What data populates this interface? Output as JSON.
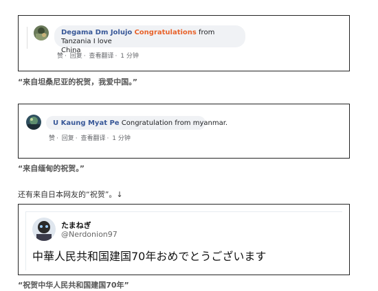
{
  "post1": {
    "name": "Degama Dm Jolujo",
    "highlight": "Congratulations",
    "text_rest": " from Tanzania I love",
    "text_line2": "China",
    "actions": [
      "赞",
      "·",
      "回复",
      "·",
      "查看翻译",
      "·",
      "1 分钟"
    ],
    "caption": "“来自坦桑尼亚的祝贺，我爱中国。”"
  },
  "post2": {
    "name": "U Kaung Myat Pe",
    "text": " Congratulation from myanmar.",
    "actions": [
      "赞",
      "·",
      "回复",
      "·",
      "查看翻译",
      "·",
      "1 分钟"
    ],
    "caption": "“来自缅甸的祝贺。”"
  },
  "note": "还有来自日本网友的“祝贺”。↓",
  "tweet": {
    "name": "たまねぎ",
    "handle": "@Nerdonion97",
    "text": "中華人民共和国建国70年おめでとうございます",
    "caption": "“祝贺中华人民共和国建国70年”"
  },
  "colors": {
    "name": "#385898",
    "highlight": "#e8632b",
    "border": "#222222"
  },
  "icons": {
    "avatar1": "avatar-photo",
    "avatar2": "avatar-photo",
    "avatar3": "avatar-photo"
  }
}
